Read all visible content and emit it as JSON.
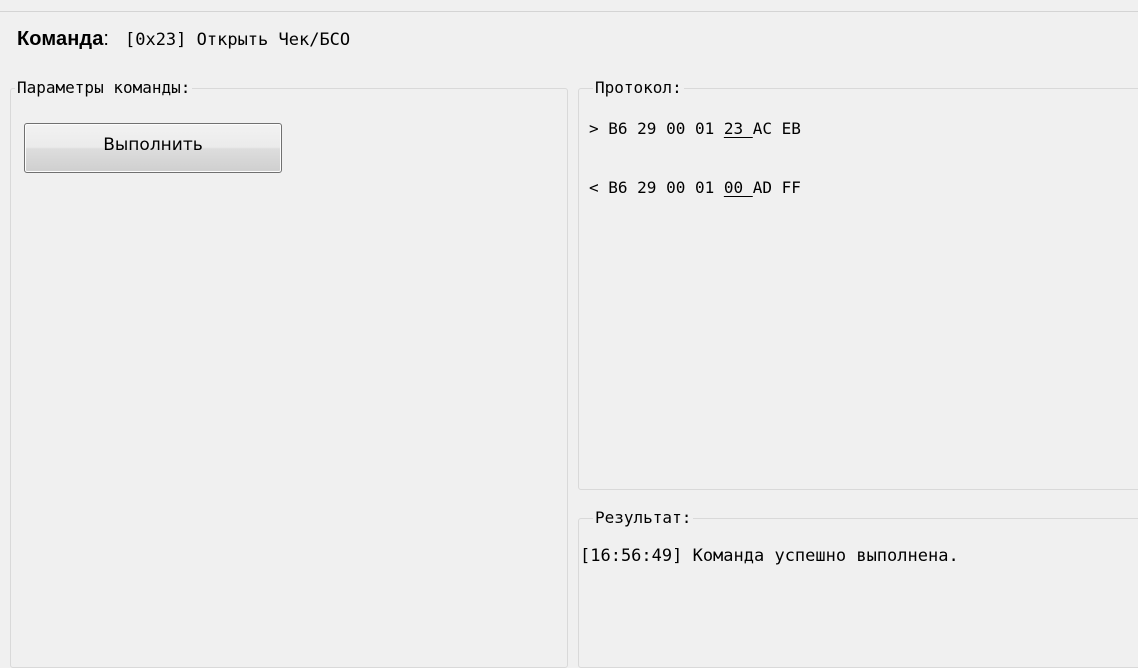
{
  "header": {
    "label": "Команда",
    "colon": ":",
    "value": "[0x23] Открыть Чек/БСО"
  },
  "params_group": {
    "title": "Параметры команды:",
    "execute_button": "Выполнить"
  },
  "protocol_group": {
    "title": "Протокол:",
    "lines": [
      {
        "prefix": "> B6 29 00 01 ",
        "code": "23 ",
        "suffix": "AC EB"
      },
      {
        "prefix": "< B6 29 00 01 ",
        "code": "00 ",
        "suffix": "AD FF"
      }
    ]
  },
  "result_group": {
    "title": "Результат:",
    "message": "[16:56:49] Команда успешно выполнена."
  }
}
